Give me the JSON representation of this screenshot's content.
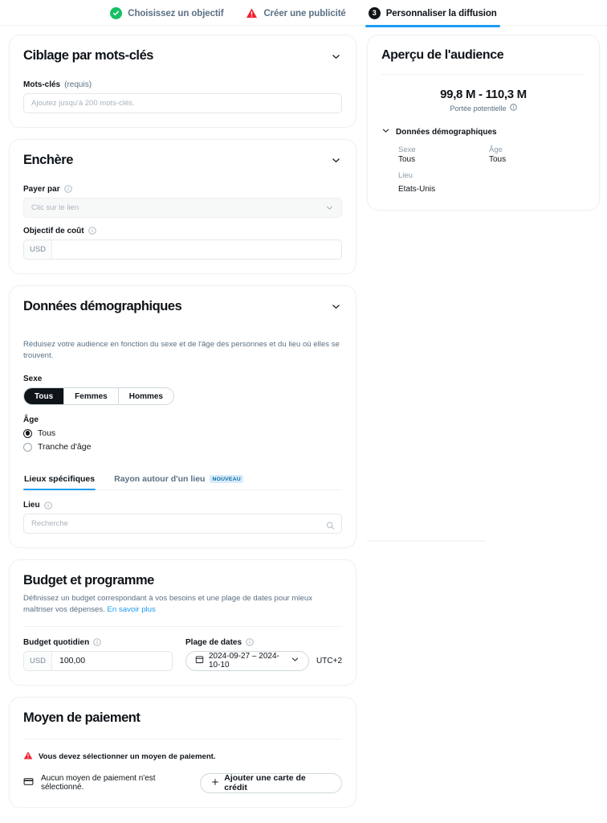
{
  "stepper": {
    "steps": [
      {
        "label": "Choisissez un objectif",
        "icon": "check-circle-icon",
        "state": "done"
      },
      {
        "label": "Créer une publicité",
        "icon": "warning-triangle-icon",
        "state": "warning"
      },
      {
        "label": "Personnaliser la diffusion",
        "icon": "step-number-icon",
        "number": "3",
        "state": "active"
      }
    ]
  },
  "keywords_card": {
    "title": "Ciblage par mots-clés",
    "chevron_icon": "chevron-down-icon",
    "label_strong": "Mots-clés",
    "label_muted": "(requis)",
    "input_placeholder": "Ajoutez jusqu'à 200 mots-clés."
  },
  "bid_card": {
    "title": "Enchère",
    "chevron_icon": "chevron-down-icon",
    "pay_by_label": "Payer par",
    "pay_by_value": "Clic sur le lien",
    "cost_goal_label": "Objectif de coût",
    "cost_currency": "USD",
    "cost_value": "",
    "info_icon": "info-icon"
  },
  "demographics_card": {
    "title": "Données démographiques",
    "chevron_icon": "chevron-down-icon",
    "description": "Réduisez votre audience en fonction du sexe et de l'âge des personnes et du lieu où elles se trouvent.",
    "gender_label": "Sexe",
    "gender_options": [
      "Tous",
      "Femmes",
      "Hommes"
    ],
    "gender_selected": "Tous",
    "age_label": "Âge",
    "age_options": [
      "Tous",
      "Tranche d'âge"
    ],
    "age_selected": "Tous",
    "tabs": [
      {
        "label": "Lieux spécifiques",
        "active": true,
        "badge": ""
      },
      {
        "label": "Rayon autour d'un lieu",
        "active": false,
        "badge": "NOUVEAU"
      }
    ],
    "place_label": "Lieu",
    "place_placeholder": "Recherche",
    "search_icon": "search-icon",
    "info_icon": "info-icon"
  },
  "budget_card": {
    "title": "Budget et programme",
    "description": "Définissez un budget correspondant à vos besoins et une plage de dates pour mieux maîtriser vos dépenses.",
    "learn_more": "En savoir plus",
    "daily_budget_label": "Budget quotidien",
    "daily_budget_currency": "USD",
    "daily_budget_value": "100,00",
    "date_range_label": "Plage de dates",
    "date_range_value": "2024-09-27 – 2024-10-10",
    "calendar_icon": "calendar-icon",
    "chevron_icon": "chevron-down-icon",
    "timezone": "UTC+2",
    "info_icon": "info-icon"
  },
  "payment_card": {
    "title": "Moyen de paiement",
    "warning_icon": "warning-triangle-icon",
    "warning_text": "Vous devez sélectionner un moyen de paiement.",
    "card_icon": "credit-card-icon",
    "status_text": "Aucun moyen de paiement n'est sélectionné.",
    "add_button_label": "Ajouter une carte de crédit",
    "plus_icon": "plus-icon"
  },
  "audience_panel": {
    "title": "Aperçu de l'audience",
    "reach_value": "99,8 M - 110,3 M",
    "reach_label": "Portée potentielle",
    "info_icon": "info-icon",
    "demographics_heading": "Données démographiques",
    "chevron_icon": "chevron-down-icon",
    "fields": {
      "gender_key": "Sexe",
      "gender_value": "Tous",
      "age_key": "Âge",
      "age_value": "Tous",
      "place_key": "Lieu",
      "place_value": "Etats-Unis"
    }
  },
  "colors": {
    "accent_blue": "#1d9bf0",
    "success_green": "#17bf63",
    "danger_red": "#f4212e",
    "text_primary": "#0f1419",
    "text_muted": "#5b7083",
    "badge_bg": "#d9ecfb"
  }
}
